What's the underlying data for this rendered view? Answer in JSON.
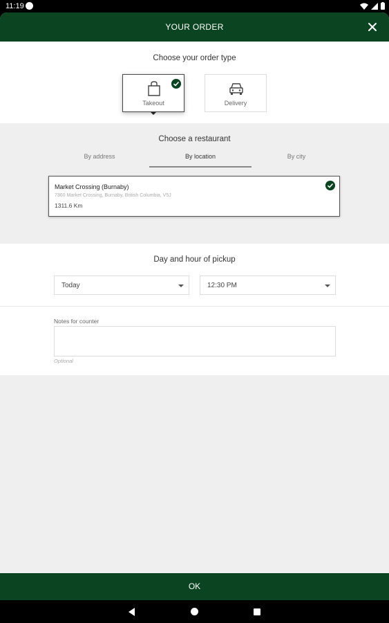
{
  "status": {
    "time": "11:19"
  },
  "header": {
    "title": "YOUR ORDER"
  },
  "order_type": {
    "title": "Choose your order type",
    "options": [
      {
        "label": "Takeout",
        "selected": true
      },
      {
        "label": "Delivery",
        "selected": false
      }
    ]
  },
  "restaurant": {
    "title": "Choose a restaurant",
    "tabs": [
      "By address",
      "By location",
      "By city"
    ],
    "active_tab": "By location",
    "card": {
      "name": "Market Crossing (Burnaby)",
      "address": "7360 Market Crossing, Burnaby, British Columbia, V5J",
      "distance": "1311.6 Km"
    }
  },
  "pickup": {
    "title": "Day and hour of pickup",
    "day": "Today",
    "hour": "12:30 PM"
  },
  "notes": {
    "label": "Notes for counter",
    "hint": "Optional"
  },
  "ok_label": "OK",
  "colors": {
    "brand": "#0b4420",
    "background": "#efefef"
  }
}
